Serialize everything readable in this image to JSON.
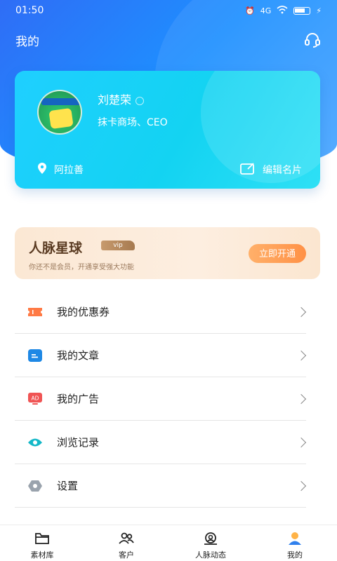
{
  "status_bar": {
    "time": "01:50",
    "network": "4G"
  },
  "header": {
    "title": "我的",
    "support_icon": "headset-icon"
  },
  "profile": {
    "name": "刘楚荣",
    "title": "抹卡商场、CEO",
    "location": "阿拉善",
    "edit_label": "编辑名片"
  },
  "vip": {
    "title": "人脉星球",
    "tag": "vip",
    "subtitle": "你还不是会员，开通享受强大功能",
    "button": "立即开通"
  },
  "menu": {
    "items": [
      {
        "label": "我的优惠券",
        "icon": "coupon-icon",
        "color": "#ff7a45"
      },
      {
        "label": "我的文章",
        "icon": "article-icon",
        "color": "#1e88e5"
      },
      {
        "label": "我的广告",
        "icon": "ad-icon",
        "color": "#f05454"
      },
      {
        "label": "浏览记录",
        "icon": "eye-icon",
        "color": "#14b8c8"
      },
      {
        "label": "设置",
        "icon": "settings-icon",
        "color": "#9aa3ad"
      }
    ]
  },
  "bottom_nav": {
    "items": [
      {
        "label": "素材库",
        "icon": "folder-icon"
      },
      {
        "label": "客户",
        "icon": "customers-icon"
      },
      {
        "label": "人脉动态",
        "icon": "network-feed-icon"
      },
      {
        "label": "我的",
        "icon": "profile-icon",
        "active": true
      }
    ]
  },
  "colors": {
    "brand_blue": "#2f6df6",
    "card_cyan": "#1fcfff",
    "vip_orange": "#ff9146"
  }
}
